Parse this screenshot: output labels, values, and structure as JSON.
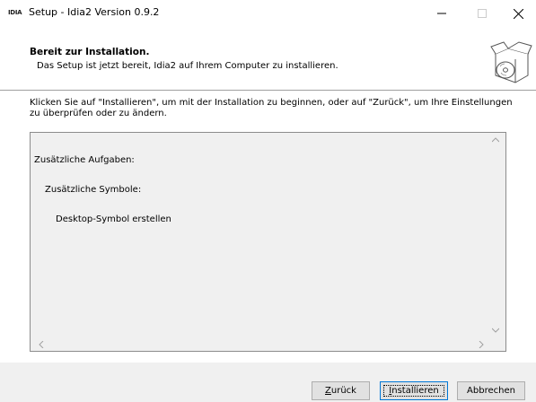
{
  "window": {
    "app_icon_text": "IDIA",
    "title": "Setup - Idia2 Version 0.9.2",
    "minimize_icon": "minimize-icon",
    "maximize_icon": "maximize-icon",
    "close_icon": "close-icon"
  },
  "header": {
    "title": "Bereit zur Installation.",
    "subtitle": "Das Setup ist jetzt bereit, Idia2 auf Ihrem Computer zu installieren.",
    "image_icon": "install-box-disc-icon"
  },
  "content": {
    "intro_line1": "Klicken Sie auf \"Installieren\", um mit der Installation zu beginnen, oder auf \"Zurück\", um Ihre Einstellungen",
    "intro_line2": "zu überprüfen oder zu ändern.",
    "memo": {
      "line1": "Zusätzliche Aufgaben:",
      "line2": "Zusätzliche Symbole:",
      "line3": "Desktop-Symbol erstellen"
    }
  },
  "buttons": {
    "back_pre": "",
    "back_u": "Z",
    "back_post": "urück",
    "install_pre": "",
    "install_u": "I",
    "install_post": "nstallieren",
    "cancel": "Abbrechen"
  },
  "colors": {
    "footer_bg": "#f0f0f0",
    "memo_bg": "#f0f0f0",
    "default_button_border": "#0078d7"
  }
}
